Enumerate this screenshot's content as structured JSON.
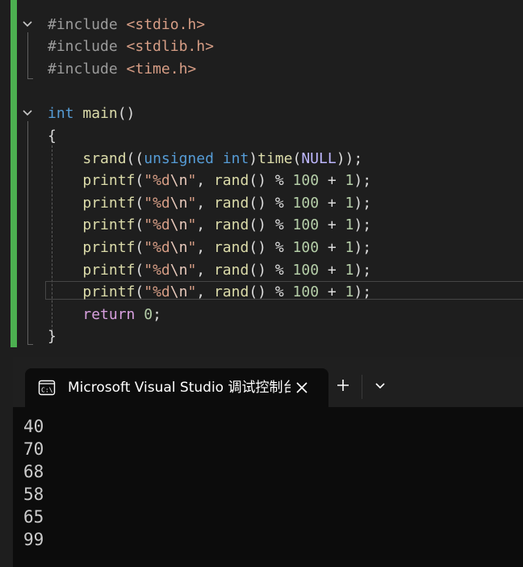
{
  "editor": {
    "lines": [
      {
        "segments": [
          [
            "pp",
            "#include "
          ],
          [
            "inc",
            "<stdio.h>"
          ]
        ]
      },
      {
        "segments": [
          [
            "pp",
            "#include "
          ],
          [
            "inc",
            "<stdlib.h>"
          ]
        ]
      },
      {
        "segments": [
          [
            "pp",
            "#include "
          ],
          [
            "inc",
            "<time.h>"
          ]
        ]
      },
      {
        "segments": []
      },
      {
        "segments": [
          [
            "kw",
            "int"
          ],
          [
            "pn",
            " "
          ],
          [
            "fn",
            "main"
          ],
          [
            "pn",
            "()"
          ]
        ]
      },
      {
        "segments": [
          [
            "pn",
            "{"
          ]
        ]
      },
      {
        "segments": [
          [
            "pn",
            "    "
          ],
          [
            "fn",
            "srand"
          ],
          [
            "pn",
            "(("
          ],
          [
            "kw",
            "unsigned int"
          ],
          [
            "pn",
            ")"
          ],
          [
            "fn",
            "time"
          ],
          [
            "pn",
            "("
          ],
          [
            "mac",
            "NULL"
          ],
          [
            "pn",
            "));"
          ]
        ]
      },
      {
        "segments": [
          [
            "pn",
            "    "
          ],
          [
            "fn",
            "printf"
          ],
          [
            "pn",
            "("
          ],
          [
            "str",
            "\"%d"
          ],
          [
            "esc",
            "\\n"
          ],
          [
            "str",
            "\""
          ],
          [
            "pn",
            ", "
          ],
          [
            "fn",
            "rand"
          ],
          [
            "pn",
            "() % "
          ],
          [
            "num",
            "100"
          ],
          [
            "pn",
            " + "
          ],
          [
            "num",
            "1"
          ],
          [
            "pn",
            ");"
          ]
        ]
      },
      {
        "segments": [
          [
            "pn",
            "    "
          ],
          [
            "fn",
            "printf"
          ],
          [
            "pn",
            "("
          ],
          [
            "str",
            "\"%d"
          ],
          [
            "esc",
            "\\n"
          ],
          [
            "str",
            "\""
          ],
          [
            "pn",
            ", "
          ],
          [
            "fn",
            "rand"
          ],
          [
            "pn",
            "() % "
          ],
          [
            "num",
            "100"
          ],
          [
            "pn",
            " + "
          ],
          [
            "num",
            "1"
          ],
          [
            "pn",
            ");"
          ]
        ]
      },
      {
        "segments": [
          [
            "pn",
            "    "
          ],
          [
            "fn",
            "printf"
          ],
          [
            "pn",
            "("
          ],
          [
            "str",
            "\"%d"
          ],
          [
            "esc",
            "\\n"
          ],
          [
            "str",
            "\""
          ],
          [
            "pn",
            ", "
          ],
          [
            "fn",
            "rand"
          ],
          [
            "pn",
            "() % "
          ],
          [
            "num",
            "100"
          ],
          [
            "pn",
            " + "
          ],
          [
            "num",
            "1"
          ],
          [
            "pn",
            ");"
          ]
        ]
      },
      {
        "segments": [
          [
            "pn",
            "    "
          ],
          [
            "fn",
            "printf"
          ],
          [
            "pn",
            "("
          ],
          [
            "str",
            "\"%d"
          ],
          [
            "esc",
            "\\n"
          ],
          [
            "str",
            "\""
          ],
          [
            "pn",
            ", "
          ],
          [
            "fn",
            "rand"
          ],
          [
            "pn",
            "() % "
          ],
          [
            "num",
            "100"
          ],
          [
            "pn",
            " + "
          ],
          [
            "num",
            "1"
          ],
          [
            "pn",
            ");"
          ]
        ]
      },
      {
        "segments": [
          [
            "pn",
            "    "
          ],
          [
            "fn",
            "printf"
          ],
          [
            "pn",
            "("
          ],
          [
            "str",
            "\"%d"
          ],
          [
            "esc",
            "\\n"
          ],
          [
            "str",
            "\""
          ],
          [
            "pn",
            ", "
          ],
          [
            "fn",
            "rand"
          ],
          [
            "pn",
            "() % "
          ],
          [
            "num",
            "100"
          ],
          [
            "pn",
            " + "
          ],
          [
            "num",
            "1"
          ],
          [
            "pn",
            ");"
          ]
        ]
      },
      {
        "segments": [
          [
            "pn",
            "    "
          ],
          [
            "fn",
            "printf"
          ],
          [
            "pn",
            "("
          ],
          [
            "str",
            "\"%d"
          ],
          [
            "esc",
            "\\n"
          ],
          [
            "str",
            "\""
          ],
          [
            "pn",
            ", "
          ],
          [
            "fn",
            "rand"
          ],
          [
            "pn",
            "() % "
          ],
          [
            "num",
            "100"
          ],
          [
            "pn",
            " + "
          ],
          [
            "num",
            "1"
          ],
          [
            "pn",
            ");"
          ]
        ]
      },
      {
        "segments": [
          [
            "pn",
            "    "
          ],
          [
            "ctl",
            "return"
          ],
          [
            "pn",
            " "
          ],
          [
            "num",
            "0"
          ],
          [
            "pn",
            ";"
          ]
        ]
      },
      {
        "segments": [
          [
            "pn",
            "}"
          ]
        ]
      }
    ],
    "fold_icons": [
      "chevron-down-icon",
      "chevron-down-icon"
    ]
  },
  "terminal": {
    "tab_title": "Microsoft Visual Studio 调试控制台",
    "tab_icon": "console-icon",
    "close_icon": "close-icon",
    "new_tab_icon": "plus-icon",
    "dropdown_icon": "chevron-down-icon",
    "output": [
      "40",
      "70",
      "68",
      "58",
      "65",
      "99"
    ]
  },
  "colors": {
    "editor_bg": "#1e1e1e",
    "change_bar": "#4caf50",
    "terminal_bg": "#0c0c0c",
    "tabstrip_bg": "#1f1f1f"
  }
}
